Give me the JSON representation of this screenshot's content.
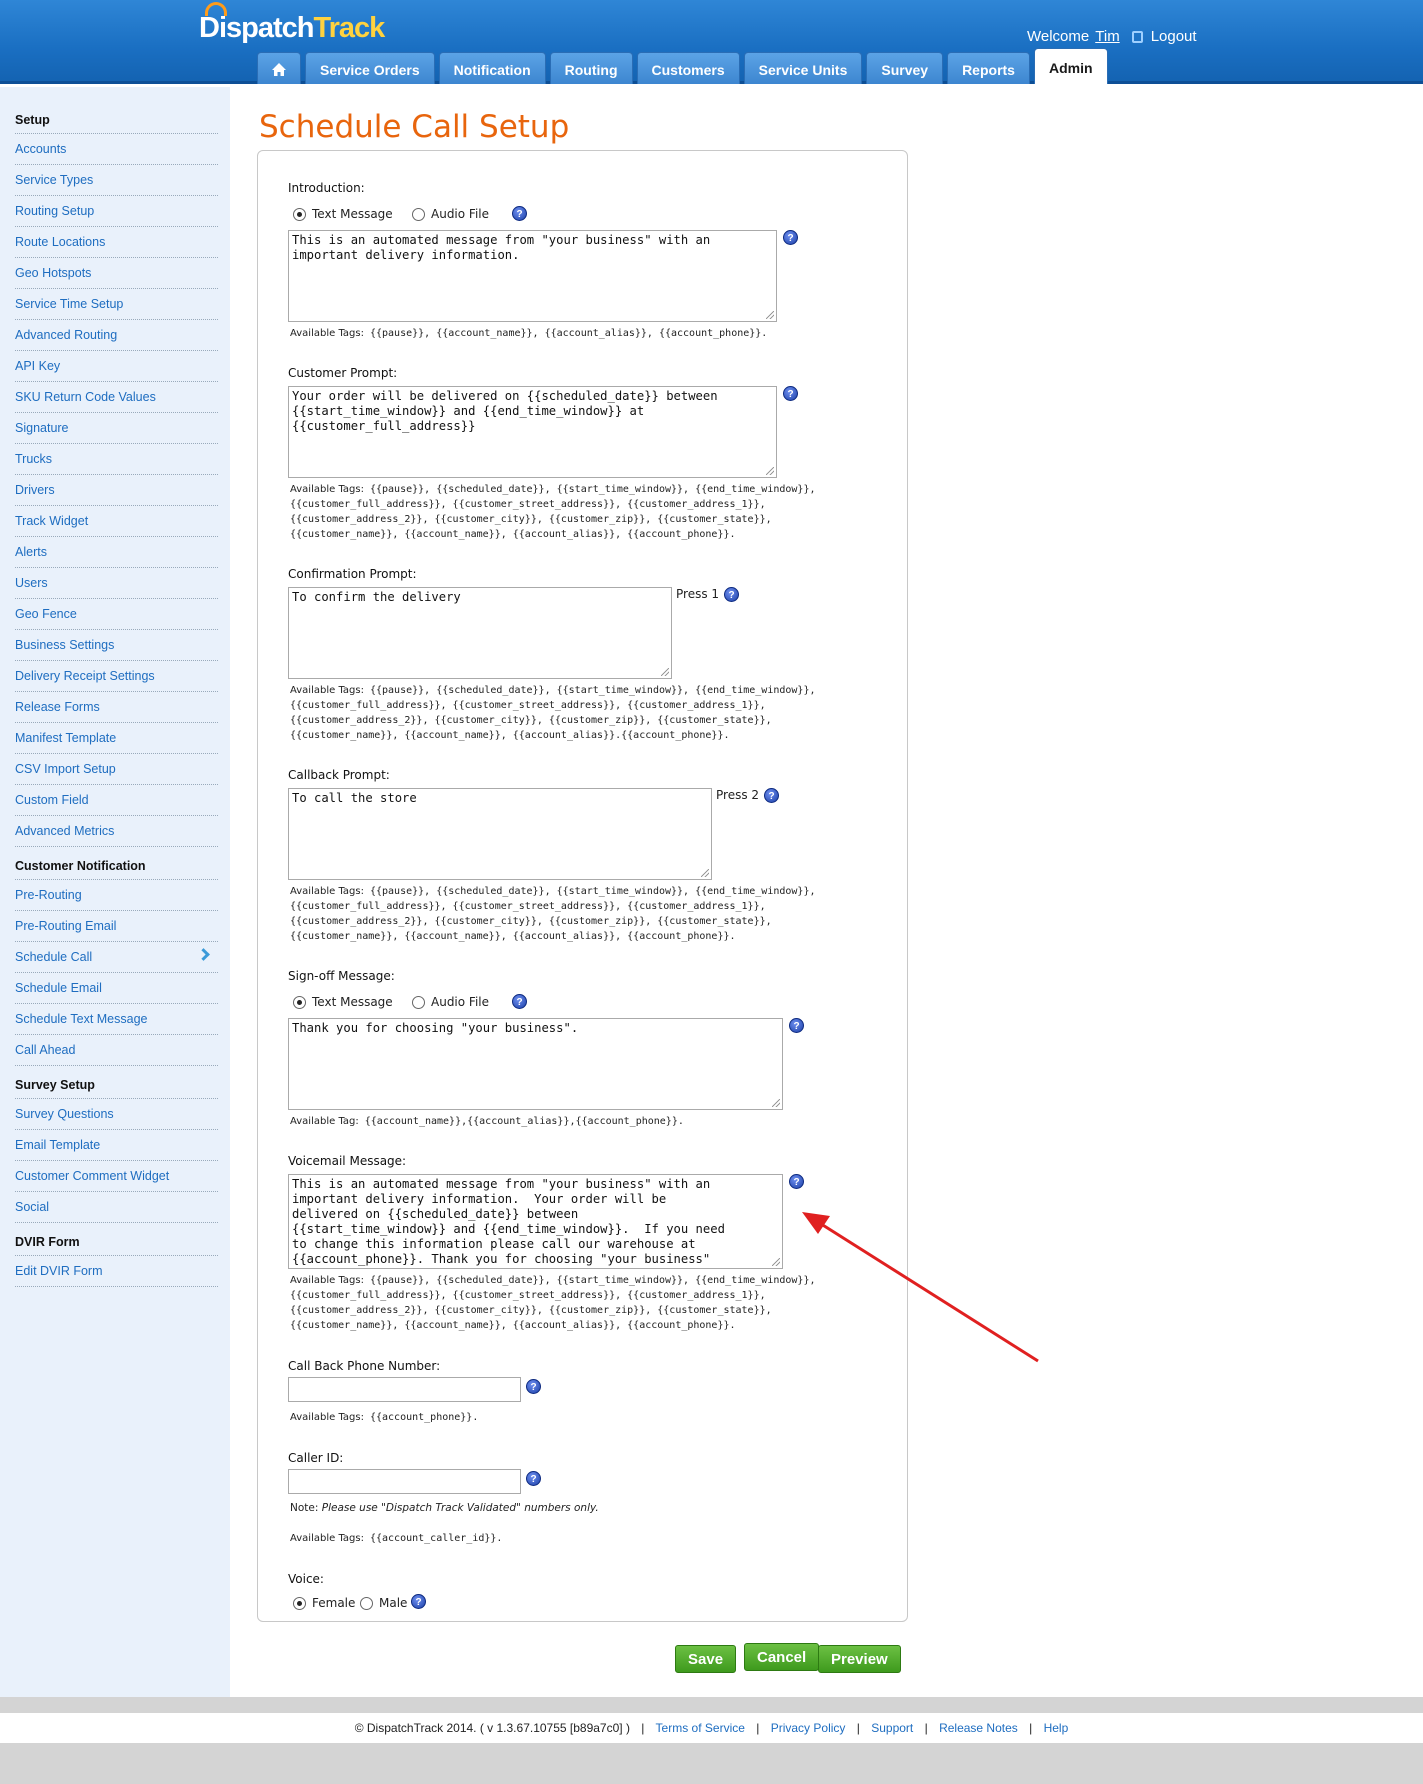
{
  "header": {
    "logo_part1": "Dispatch",
    "logo_part2": "Track",
    "welcome": "Welcome",
    "user": "Tim",
    "logout": "Logout",
    "tabs": [
      "Service Orders",
      "Notification",
      "Routing",
      "Customers",
      "Service Units",
      "Survey",
      "Reports",
      "Admin"
    ]
  },
  "sidebar": {
    "setup_title": "Setup",
    "setup_items": [
      "Accounts",
      "Service Types",
      "Routing Setup",
      "Route Locations",
      "Geo Hotspots",
      "Service Time Setup",
      "Advanced Routing",
      "API Key",
      "SKU Return Code Values",
      "Signature",
      "Trucks",
      "Drivers",
      "Track Widget",
      "Alerts",
      "Users",
      "Geo Fence",
      "Business Settings",
      "Delivery Receipt Settings",
      "Release Forms",
      "Manifest Template",
      "CSV Import Setup",
      "Custom Field",
      "Advanced Metrics"
    ],
    "notif_title": "Customer Notification",
    "notif_items": [
      "Pre-Routing",
      "Pre-Routing Email",
      "Schedule Call",
      "Schedule Email",
      "Schedule Text Message",
      "Call Ahead"
    ],
    "survey_title": "Survey Setup",
    "survey_items": [
      "Survey Questions",
      "Email Template",
      "Customer Comment Widget",
      "Social"
    ],
    "dvir_title": "DVIR Form",
    "dvir_items": [
      "Edit DVIR Form"
    ]
  },
  "page_title": "Schedule Call Setup",
  "form": {
    "intro_label": "Introduction:",
    "text_message": "Text Message",
    "audio_file": "Audio File",
    "intro_text": "This is an automated message from \"your business\" with an\nimportant delivery information.",
    "tags_prefix": "Available Tags:",
    "tag_prefix_single": "Available Tag:",
    "intro_tags": " {{pause}}, {{account_name}}, {{account_alias}}, {{account_phone}}.",
    "customer_label": "Customer Prompt:",
    "customer_text": "Your order will be delivered on {{scheduled_date}} between\n{{start_time_window}} and {{end_time_window}} at\n{{customer_full_address}}",
    "full_tags_line1": " {{pause}}, {{scheduled_date}}, {{start_time_window}}, {{end_time_window}},",
    "full_tags_line2": "{{customer_full_address}}, {{customer_street_address}}, {{customer_address_1}},",
    "full_tags_line3": "{{customer_address_2}}, {{customer_city}}, {{customer_zip}}, {{customer_state}},",
    "full_tags_line4": "{{customer_name}}, {{account_name}}, {{account_alias}}, {{account_phone}}.",
    "full_tags_line4_alt": "{{customer_name}}, {{account_name}}, {{account_alias}}.{{account_phone}}.",
    "confirm_label": "Confirmation Prompt:",
    "confirm_text": "To confirm the delivery",
    "press1": "Press 1",
    "callback_label": "Callback Prompt:",
    "callback_text": "To call the store",
    "press2": "Press 2",
    "signoff_label": "Sign-off Message:",
    "signoff_text": "Thank you for choosing \"your business\".",
    "signoff_tags": " {{account_name}},{{account_alias}},{{account_phone}}.",
    "voicemail_label": "Voicemail Message:",
    "voicemail_text": "This is an automated message from \"your business\" with an\nimportant delivery information.  Your order will be\ndelivered on {{scheduled_date}} between\n{{start_time_window}} and {{end_time_window}}.  If you need\nto change this information please call our warehouse at\n{{account_phone}}. Thank you for choosing \"your business\"",
    "callback_phone_label": "Call Back Phone Number:",
    "callback_phone_tags": " {{account_phone}}.",
    "caller_id_label": "Caller ID:",
    "note_prefix": "Note:",
    "note_text": "Please use \"Dispatch Track Validated\" numbers only.",
    "caller_tags": " {{account_caller_id}}.",
    "voice_label": "Voice:",
    "female": "Female",
    "male": "Male",
    "help": "?"
  },
  "buttons": {
    "save": "Save",
    "cancel": "Cancel",
    "preview": "Preview"
  },
  "footer": {
    "copyright": "© DispatchTrack 2014. ( v 1.3.67.10755 [b89a7c0] )",
    "links": [
      "Terms of Service",
      "Privacy Policy",
      "Support",
      "Release Notes",
      "Help"
    ]
  },
  "colors": {
    "accent_orange": "#e8650d",
    "header_blue": "#1a6fc2",
    "button_green": "#4ea828",
    "link_blue": "#1e6dc0"
  }
}
